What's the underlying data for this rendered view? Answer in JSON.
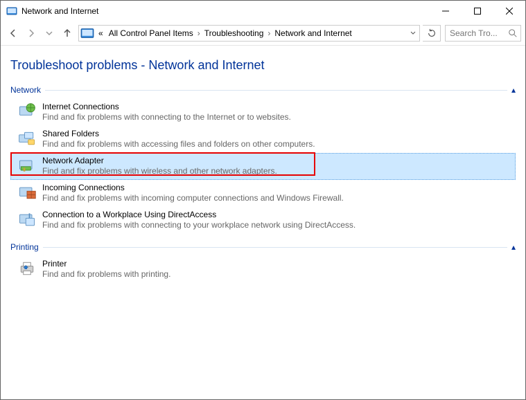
{
  "window": {
    "title": "Network and Internet"
  },
  "breadcrumbs": [
    "All Control Panel Items",
    "Troubleshooting",
    "Network and Internet"
  ],
  "search": {
    "placeholder": "Search Tro..."
  },
  "page": {
    "heading": "Troubleshoot problems - Network and Internet"
  },
  "sections": [
    {
      "title": "Network",
      "items": [
        {
          "name": "Internet Connections",
          "desc": "Find and fix problems with connecting to the Internet or to websites."
        },
        {
          "name": "Shared Folders",
          "desc": "Find and fix problems with accessing files and folders on other computers."
        },
        {
          "name": "Network Adapter",
          "desc": "Find and fix problems with wireless and other network adapters."
        },
        {
          "name": "Incoming Connections",
          "desc": "Find and fix problems with incoming computer connections and Windows Firewall."
        },
        {
          "name": "Connection to a Workplace Using DirectAccess",
          "desc": "Find and fix problems with connecting to your workplace network using DirectAccess."
        }
      ]
    },
    {
      "title": "Printing",
      "items": [
        {
          "name": "Printer",
          "desc": "Find and fix problems with printing."
        }
      ]
    }
  ]
}
